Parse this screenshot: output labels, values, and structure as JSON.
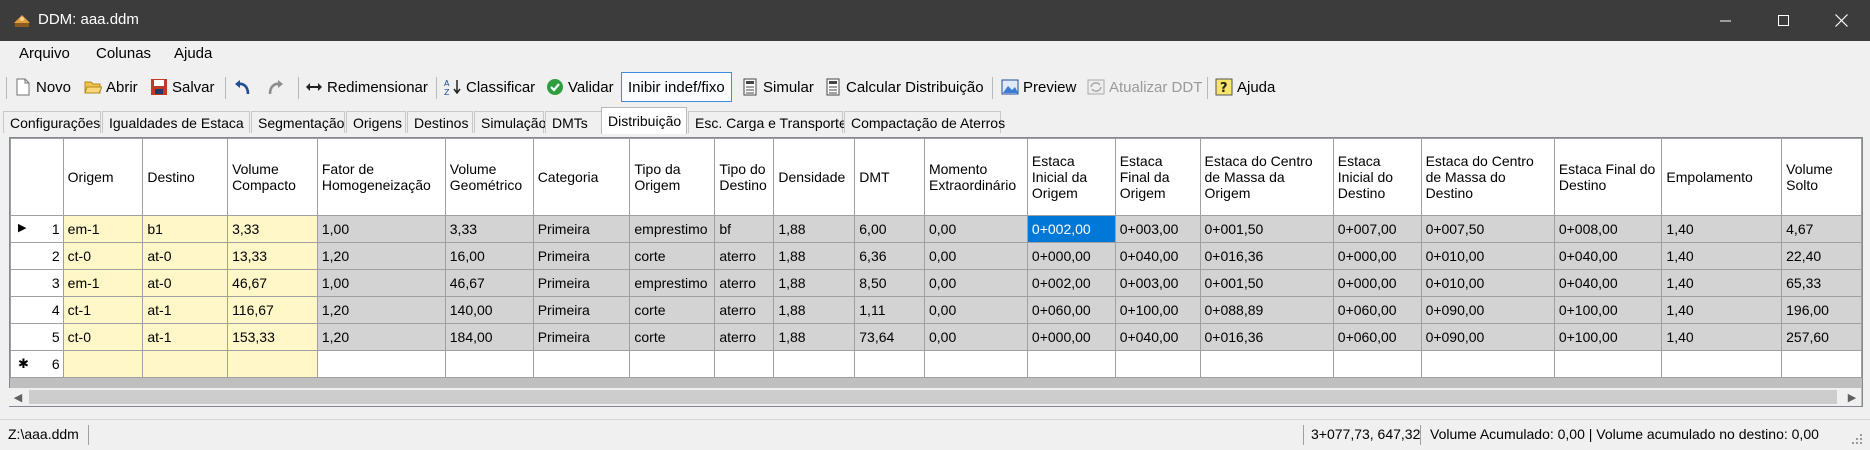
{
  "window": {
    "title": "DDM: aaa.ddm"
  },
  "menu": {
    "items": [
      "Arquivo",
      "Colunas",
      "Ajuda"
    ]
  },
  "toolbar": {
    "novo": "Novo",
    "abrir": "Abrir",
    "salvar": "Salvar",
    "redimensionar": "Redimensionar",
    "classificar": "Classificar",
    "validar": "Validar",
    "inibir": "Inibir indef/fixo",
    "simular": "Simular",
    "calcular": "Calcular Distribuição",
    "preview": "Preview",
    "atualizar": "Atualizar DDT",
    "ajuda": "Ajuda"
  },
  "tabs": [
    "Configurações",
    "Igualdades de Estaca",
    "Segmentação",
    "Origens",
    "Destinos",
    "Simulação",
    "DMTs",
    "Distribuição",
    "Esc. Carga e Transporte",
    "Compactação de Aterros"
  ],
  "columns": [
    "Origem",
    "Destino",
    "Volume Compacto",
    "Fator de Homogeneização",
    "Volume Geométrico",
    "Categoria",
    "Tipo da Origem",
    "Tipo do Destino",
    "Densidade",
    "DMT",
    "Momento Extraordinário",
    "Estaca Inicial da Origem",
    "Estaca Final da Origem",
    "Estaca do Centro de Massa da Origem",
    "Estaca Inicial do Destino",
    "Estaca do Centro de Massa do Destino",
    "Estaca Final do Destino",
    "Empolamento",
    "Volume Solto"
  ],
  "rows": [
    {
      "n": "1",
      "cells": [
        "em-1",
        "b1",
        "3,33",
        "1,00",
        "3,33",
        "Primeira",
        "emprestimo",
        "bf",
        "1,88",
        "6,00",
        "0,00",
        "0+002,00",
        "0+003,00",
        "0+001,50",
        "0+007,00",
        "0+007,50",
        "0+008,00",
        "1,40",
        "4,67"
      ]
    },
    {
      "n": "2",
      "cells": [
        "ct-0",
        "at-0",
        "13,33",
        "1,20",
        "16,00",
        "Primeira",
        "corte",
        "aterro",
        "1,88",
        "6,36",
        "0,00",
        "0+000,00",
        "0+040,00",
        "0+016,36",
        "0+000,00",
        "0+010,00",
        "0+040,00",
        "1,40",
        "22,40"
      ]
    },
    {
      "n": "3",
      "cells": [
        "em-1",
        "at-0",
        "46,67",
        "1,00",
        "46,67",
        "Primeira",
        "emprestimo",
        "aterro",
        "1,88",
        "8,50",
        "0,00",
        "0+002,00",
        "0+003,00",
        "0+001,50",
        "0+000,00",
        "0+010,00",
        "0+040,00",
        "1,40",
        "65,33"
      ]
    },
    {
      "n": "4",
      "cells": [
        "ct-1",
        "at-1",
        "116,67",
        "1,20",
        "140,00",
        "Primeira",
        "corte",
        "aterro",
        "1,88",
        "1,11",
        "0,00",
        "0+060,00",
        "0+100,00",
        "0+088,89",
        "0+060,00",
        "0+090,00",
        "0+100,00",
        "1,40",
        "196,00"
      ]
    },
    {
      "n": "5",
      "cells": [
        "ct-0",
        "at-1",
        "153,33",
        "1,20",
        "184,00",
        "Primeira",
        "corte",
        "aterro",
        "1,88",
        "73,64",
        "0,00",
        "0+000,00",
        "0+040,00",
        "0+016,36",
        "0+060,00",
        "0+090,00",
        "0+100,00",
        "1,40",
        "257,60"
      ]
    }
  ],
  "new_row": {
    "n": "6",
    "marker": "✱"
  },
  "current_row_marker": "▶",
  "selected_cell": {
    "row": 0,
    "col": 11
  },
  "status": {
    "path": "Z:\\aaa.ddm",
    "coords": "3+077,73, 647,32",
    "volume": "Volume Acumulado: 0,00 | Volume acumulado no destino: 0,00"
  },
  "colors": {
    "titlebar": "#3c3c3c",
    "selection": "#0078d7",
    "input_cells": "#fff7c8",
    "grid_bg": "#d3d3d3"
  },
  "icons": [
    "app-icon",
    "new-doc-icon",
    "open-folder-icon",
    "save-icon",
    "undo-icon",
    "redo-icon",
    "resize-icon",
    "sort-icon",
    "check-icon",
    "calculator-icon",
    "preview-icon",
    "refresh-icon",
    "help-icon"
  ]
}
